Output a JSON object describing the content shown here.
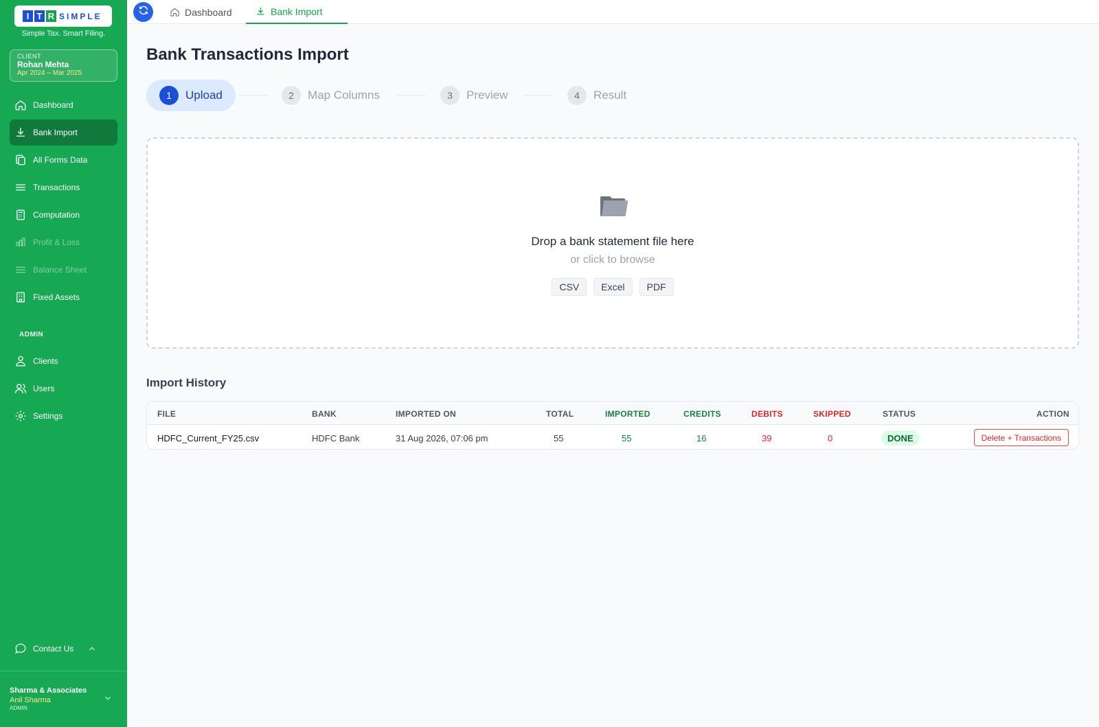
{
  "brand": {
    "letters": [
      "I",
      "T",
      "R"
    ],
    "word": "SIMPLE",
    "tagline": "Simple Tax. Smart Filing."
  },
  "client": {
    "label": "CLIENT",
    "name": "Rohan Mehta",
    "period": "Apr 2024 – Mar 2025"
  },
  "sidebar": {
    "items": [
      {
        "label": "Dashboard",
        "icon": "home-icon"
      },
      {
        "label": "Bank Import",
        "icon": "download-icon"
      },
      {
        "label": "All Forms Data",
        "icon": "copy-icon"
      },
      {
        "label": "Transactions",
        "icon": "list-icon"
      },
      {
        "label": "Computation",
        "icon": "calculator-icon"
      },
      {
        "label": "Profit & Loss",
        "icon": "bar-chart-icon"
      },
      {
        "label": "Balance Sheet",
        "icon": "list-icon"
      },
      {
        "label": "Fixed Assets",
        "icon": "building-icon"
      }
    ],
    "admin_label": "ADMIN",
    "admin_items": [
      {
        "label": "Clients",
        "icon": "user-network-icon"
      },
      {
        "label": "Users",
        "icon": "users-icon"
      },
      {
        "label": "Settings",
        "icon": "gear-icon"
      }
    ],
    "contact_label": "Contact Us",
    "footer": {
      "org": "Sharma & Associates",
      "user": "Anil Sharma",
      "role": "ADMIN"
    }
  },
  "topbar": {
    "tabs": [
      {
        "label": "Dashboard",
        "icon": "home-icon"
      },
      {
        "label": "Bank Import",
        "icon": "download-icon"
      }
    ]
  },
  "main": {
    "title": "Bank Transactions Import",
    "steps": [
      {
        "num": "1",
        "label": "Upload"
      },
      {
        "num": "2",
        "label": "Map Columns"
      },
      {
        "num": "3",
        "label": "Preview"
      },
      {
        "num": "4",
        "label": "Result"
      }
    ],
    "dropzone": {
      "title": "Drop a bank statement file here",
      "subtitle": "or click to browse",
      "formats": [
        "CSV",
        "Excel",
        "PDF"
      ]
    },
    "history": {
      "title": "Import History",
      "headers": [
        "FILE",
        "BANK",
        "IMPORTED ON",
        "TOTAL",
        "IMPORTED",
        "CREDITS",
        "DEBITS",
        "SKIPPED",
        "STATUS",
        "ACTION"
      ],
      "rows": [
        {
          "file": "HDFC_Current_FY25.csv",
          "bank": "HDFC Bank",
          "imported_on": "31 Aug 2026, 07:06 pm",
          "total": "55",
          "imported": "55",
          "credits": "16",
          "debits": "39",
          "skipped": "0",
          "status": "DONE",
          "action": "Delete + Transactions"
        }
      ]
    }
  },
  "colors": {
    "sidebar": "#17a853",
    "active_nav": "#0f7a3c",
    "primary_blue": "#1d4ed8",
    "success": "#15803d",
    "danger": "#dc2626"
  }
}
